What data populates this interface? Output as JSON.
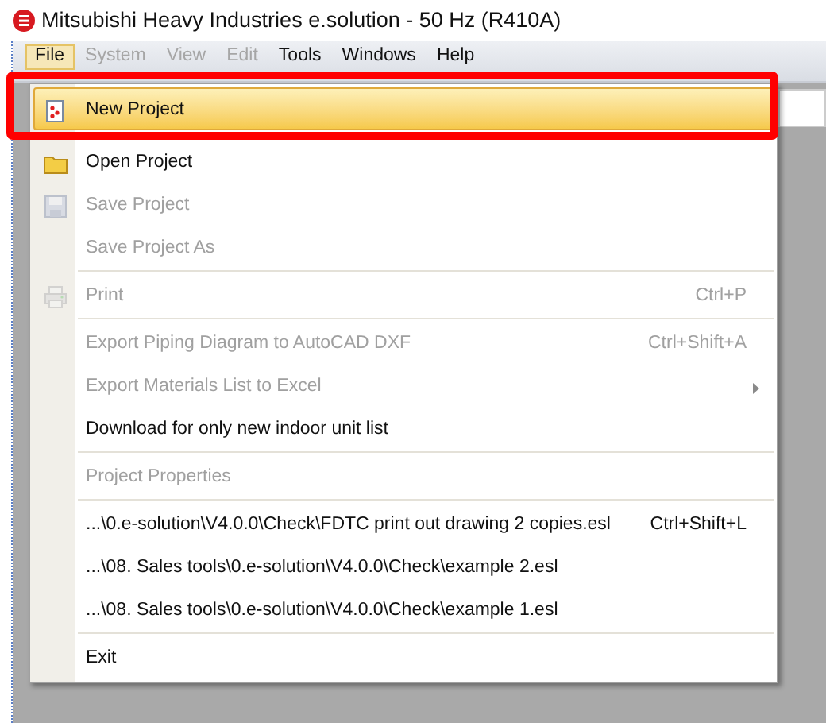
{
  "window": {
    "title": "Mitsubishi Heavy Industries e.solution - 50 Hz (R410A)"
  },
  "menu_bar": [
    {
      "label": "File",
      "selected": true,
      "disabled": false
    },
    {
      "label": "System",
      "selected": false,
      "disabled": true
    },
    {
      "label": "View",
      "selected": false,
      "disabled": true
    },
    {
      "label": "Edit",
      "selected": false,
      "disabled": true
    },
    {
      "label": "Tools",
      "selected": false,
      "disabled": false
    },
    {
      "label": "Windows",
      "selected": false,
      "disabled": false
    },
    {
      "label": "Help",
      "selected": false,
      "disabled": false
    }
  ],
  "file_menu": [
    {
      "kind": "item",
      "label": "New Project",
      "disabled": false,
      "selected": true
    },
    {
      "kind": "item",
      "label": "Open Project",
      "disabled": false,
      "selected": false
    },
    {
      "kind": "item",
      "label": "Save Project",
      "disabled": true,
      "selected": false
    },
    {
      "kind": "item",
      "label": "Save Project As",
      "disabled": true,
      "selected": false
    },
    {
      "kind": "separator"
    },
    {
      "kind": "item",
      "label": "Print",
      "shortcut": "Ctrl+P",
      "disabled": true,
      "selected": false
    },
    {
      "kind": "separator"
    },
    {
      "kind": "item",
      "label": "Export Piping Diagram to AutoCAD DXF",
      "shortcut": "Ctrl+Shift+A",
      "disabled": true,
      "selected": false
    },
    {
      "kind": "item",
      "label": "Export Materials List to Excel",
      "submenu": true,
      "disabled": true,
      "selected": false
    },
    {
      "kind": "item",
      "label": "Download for only new indoor unit list",
      "disabled": false,
      "selected": false
    },
    {
      "kind": "separator"
    },
    {
      "kind": "item",
      "label": "Project Properties",
      "disabled": true,
      "selected": false
    },
    {
      "kind": "separator"
    },
    {
      "kind": "item",
      "label": "...\\0.e-solution\\V4.0.0\\Check\\FDTC print out drawing 2 copies.esl",
      "shortcut": "Ctrl+Shift+L",
      "disabled": false,
      "selected": false
    },
    {
      "kind": "item",
      "label": "...\\08. Sales tools\\0.e-solution\\V4.0.0\\Check\\example 2.esl",
      "disabled": false,
      "selected": false
    },
    {
      "kind": "item",
      "label": "...\\08. Sales tools\\0.e-solution\\V4.0.0\\Check\\example 1.esl",
      "disabled": false,
      "selected": false
    },
    {
      "kind": "separator"
    },
    {
      "kind": "item",
      "label": "Exit",
      "disabled": false,
      "selected": false
    }
  ],
  "highlight_frame": {
    "kind": "annotation"
  }
}
